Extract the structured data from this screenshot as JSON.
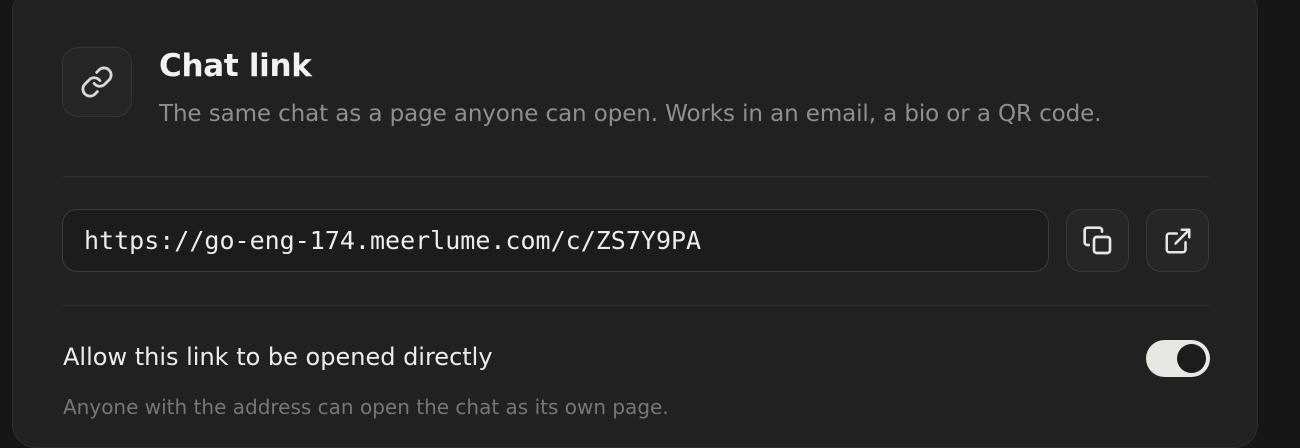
{
  "header": {
    "icon": "link-icon",
    "title": "Chat link",
    "subtitle": "The same chat as a page anyone can open. Works in an email, a bio or a QR code."
  },
  "link": {
    "url": "https://go-eng-174.meerlume.com/c/ZS7Y9PA",
    "copy_icon": "copy-icon",
    "open_icon": "external-link-icon"
  },
  "direct_open": {
    "label": "Allow this link to be opened directly",
    "description": "Anyone with the address can open the chat as its own page.",
    "enabled": true
  },
  "colors": {
    "card_background": "#212121",
    "toggle_track_on": "#e8e8e2",
    "toggle_knob": "#1c1c1c"
  }
}
